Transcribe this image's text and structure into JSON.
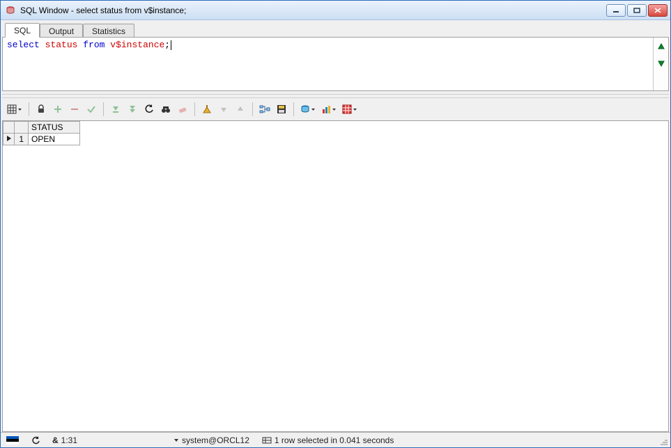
{
  "window": {
    "title": "SQL Window - select status from v$instance;"
  },
  "tabs": [
    {
      "label": "SQL",
      "active": true
    },
    {
      "label": "Output",
      "active": false
    },
    {
      "label": "Statistics",
      "active": false
    }
  ],
  "editor": {
    "sql_keyword_select": "select",
    "sql_ident_status": "status",
    "sql_keyword_from": "from",
    "sql_ident_table": "v$instance",
    "sql_terminator": ";"
  },
  "toolbar": {
    "grid_options": "grid-options",
    "lock": "lock",
    "add_row": "add-row",
    "delete_row": "delete-row",
    "commit": "commit",
    "fetch_next": "fetch-next",
    "fetch_all": "fetch-all",
    "refresh": "refresh",
    "find": "find",
    "clear": "clear",
    "query_by_example": "query-by-example",
    "export": "export",
    "save": "save",
    "print": "print",
    "chart": "chart",
    "report": "report"
  },
  "results": {
    "columns": [
      "STATUS"
    ],
    "rows": [
      {
        "n": "1",
        "STATUS": "OPEN"
      }
    ]
  },
  "status": {
    "time": "1:31",
    "connection": "system@ORCL12",
    "message": "1 row selected in 0.041 seconds",
    "user_glyph": "&"
  }
}
